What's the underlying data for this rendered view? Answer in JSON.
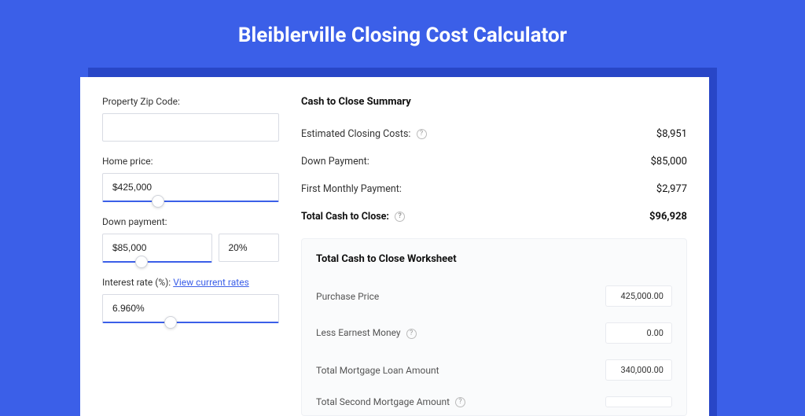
{
  "title": "Bleiblerville Closing Cost Calculator",
  "left": {
    "zip_label": "Property Zip Code:",
    "zip_value": "",
    "home_price_label": "Home price:",
    "home_price_value": "$425,000",
    "home_price_slider_pct": 28,
    "down_payment_label": "Down payment:",
    "down_payment_value": "$85,000",
    "down_payment_pct": "20%",
    "down_payment_slider_pct": 30,
    "interest_label": "Interest rate (%):",
    "interest_link": "View current rates",
    "interest_value": "6.960%",
    "interest_slider_pct": 35
  },
  "summary": {
    "title": "Cash to Close Summary",
    "closing_costs_label": "Estimated Closing Costs:",
    "closing_costs_value": "$8,951",
    "down_payment_label": "Down Payment:",
    "down_payment_value": "$85,000",
    "first_monthly_label": "First Monthly Payment:",
    "first_monthly_value": "$2,977",
    "total_label": "Total Cash to Close:",
    "total_value": "$96,928"
  },
  "worksheet": {
    "title": "Total Cash to Close Worksheet",
    "rows": [
      {
        "label": "Purchase Price",
        "value": "425,000.00",
        "help": false
      },
      {
        "label": "Less Earnest Money",
        "value": "0.00",
        "help": true
      },
      {
        "label": "Total Mortgage Loan Amount",
        "value": "340,000.00",
        "help": false
      },
      {
        "label": "Total Second Mortgage Amount",
        "value": "",
        "help": true
      }
    ]
  }
}
